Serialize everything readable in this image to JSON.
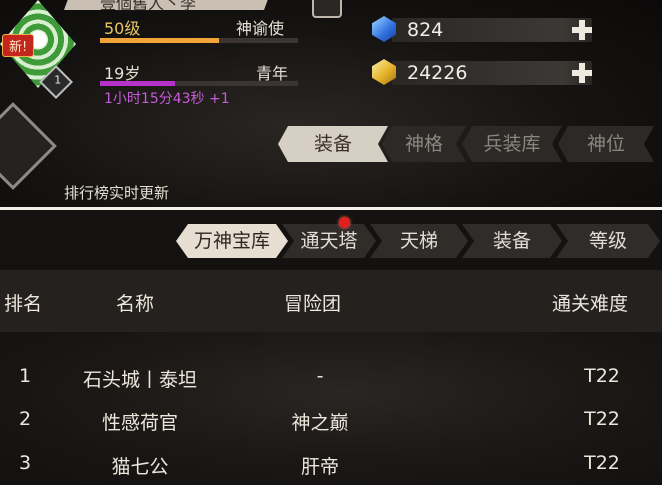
{
  "profile": {
    "name": "壹個舊人丶李",
    "new_badge": "新!",
    "avatar_level": "1",
    "level": "50级",
    "title": "神谕使",
    "level_progress": 0.6,
    "age": "19岁",
    "stage": "青年",
    "age_progress": 0.38,
    "timer": "1小时15分43秒 +1"
  },
  "currency": {
    "diamond": {
      "icon": "blue-gem-icon",
      "value": "824"
    },
    "gold": {
      "icon": "gold-gem-icon",
      "value": "24226"
    }
  },
  "top_tabs": [
    "装备",
    "神格",
    "兵装库",
    "神位"
  ],
  "update_notice": "排行榜实时更新",
  "sub_tabs": [
    "万神宝库",
    "通天塔",
    "天梯",
    "装备",
    "等级"
  ],
  "table": {
    "headers": [
      "排名",
      "名称",
      "冒险团",
      "通关难度"
    ],
    "rows": [
      {
        "rank": "1",
        "name": "石头城丨泰坦",
        "team": "-",
        "difficulty": "T22"
      },
      {
        "rank": "2",
        "name": "性感荷官",
        "team": "神之巅",
        "difficulty": "T22"
      },
      {
        "rank": "3",
        "name": "猫七公",
        "team": "肝帝",
        "difficulty": "T22"
      }
    ]
  },
  "colors": {
    "accent_gold": "#e8c566",
    "accent_purple": "#c65bd8",
    "level_bar": "#f0a43a",
    "age_bar": "#b632c8",
    "notification": "#e0201b"
  }
}
